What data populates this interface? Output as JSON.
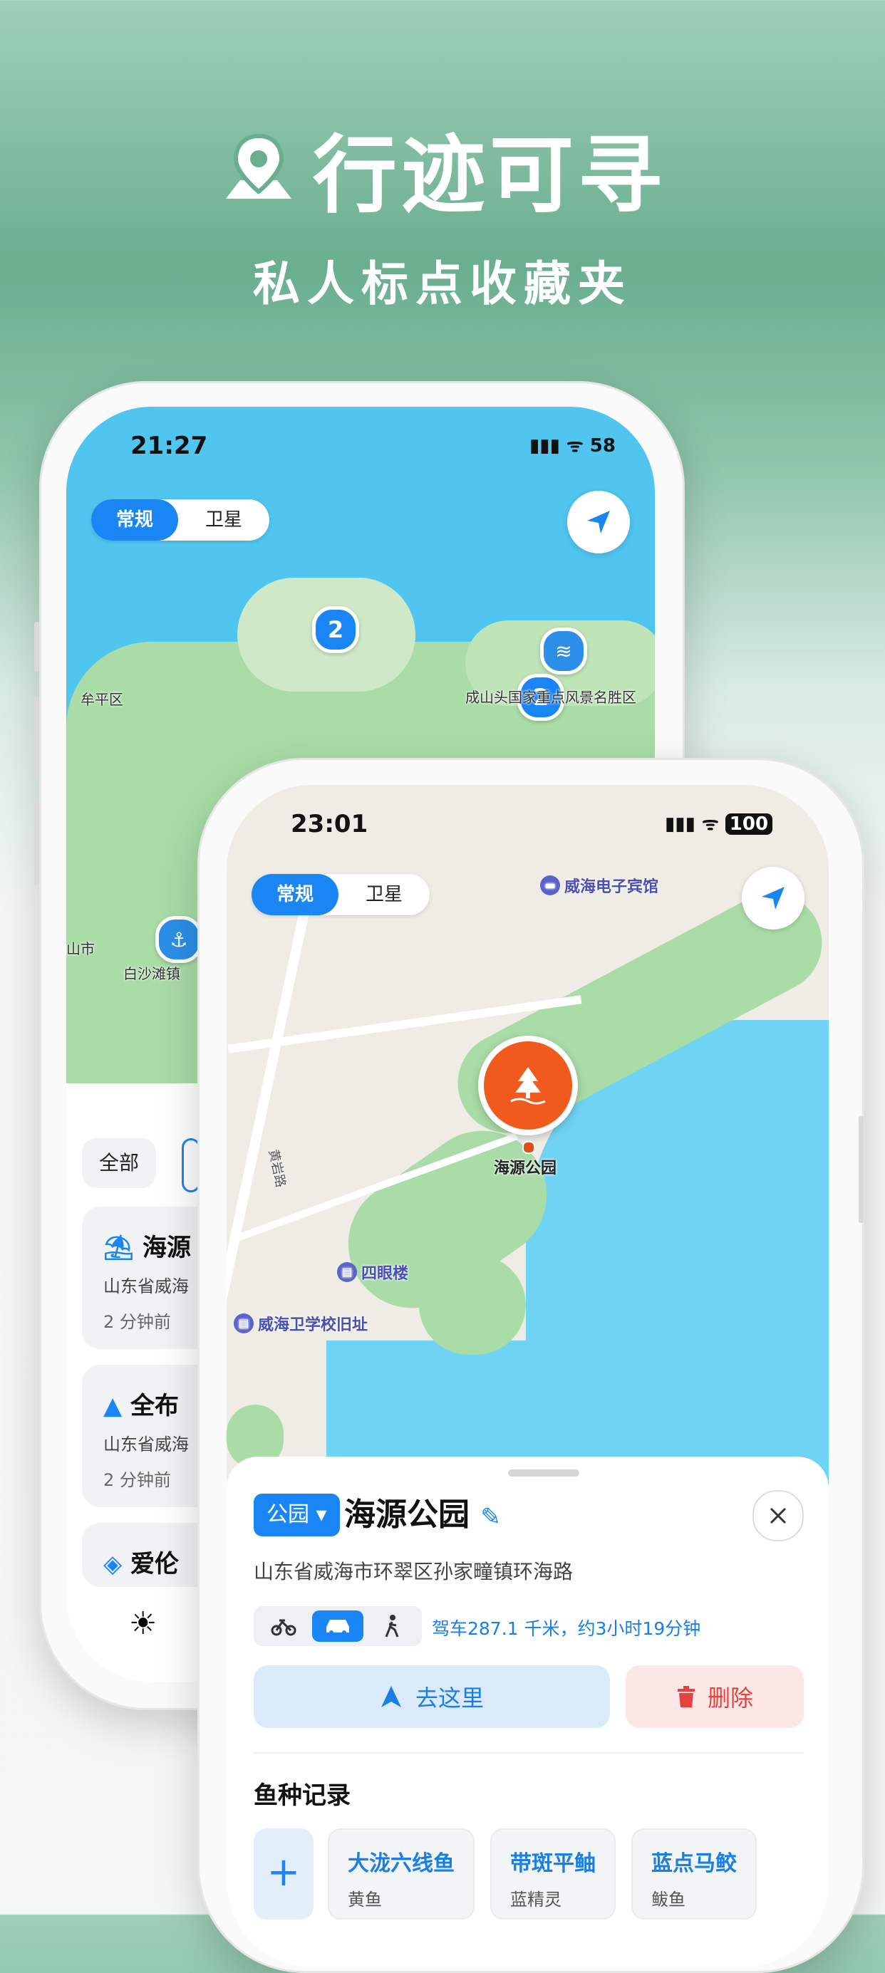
{
  "hero": {
    "title": "行迹可寻",
    "subtitle": "私人标点收藏夹"
  },
  "back_phone": {
    "status": {
      "time": "21:27",
      "battery": "58"
    },
    "map_mode": {
      "standard": "常规",
      "satellite": "卫星"
    },
    "clusters": [
      "2",
      "2"
    ],
    "labels": {
      "muping": "牟平区",
      "chengshantou": "成山头国家重点风景名胜区",
      "baisha": "白沙滩镇",
      "shan": "山市"
    },
    "filter": {
      "all": "全部"
    },
    "list": [
      {
        "title": "海源",
        "addr": "山东省威海",
        "time": "2 分钟前"
      },
      {
        "title": "全布",
        "addr": "山东省威海",
        "time": "2 分钟前"
      },
      {
        "title": "爱伦"
      }
    ]
  },
  "front_phone": {
    "status": {
      "time": "23:01",
      "battery": "100"
    },
    "map_mode": {
      "standard": "常规",
      "satellite": "卫星"
    },
    "pois": {
      "hotel": "威海电子宾馆",
      "park": "海源公园",
      "silou": "四眼楼",
      "weihai": "威海卫学校旧址",
      "road": "黄岩路"
    },
    "detail": {
      "category": "公园",
      "title": "海源公园",
      "address": "山东省威海市环翠区孙家疃镇环海路",
      "route": "驾车287.1 千米，约3小时19分钟",
      "go": "去这里",
      "delete": "删除",
      "fish_section": "鱼种记录",
      "add": "+",
      "fish": [
        {
          "name": "大泷六线鱼",
          "alias": "黄鱼"
        },
        {
          "name": "带斑平鲉",
          "alias": "蓝精灵"
        },
        {
          "name": "蓝点马鲛",
          "alias": "鲅鱼"
        }
      ]
    }
  },
  "colors": {
    "accent": "#1a86f6",
    "danger": "#e5413f",
    "marker": "#f05a1d"
  }
}
